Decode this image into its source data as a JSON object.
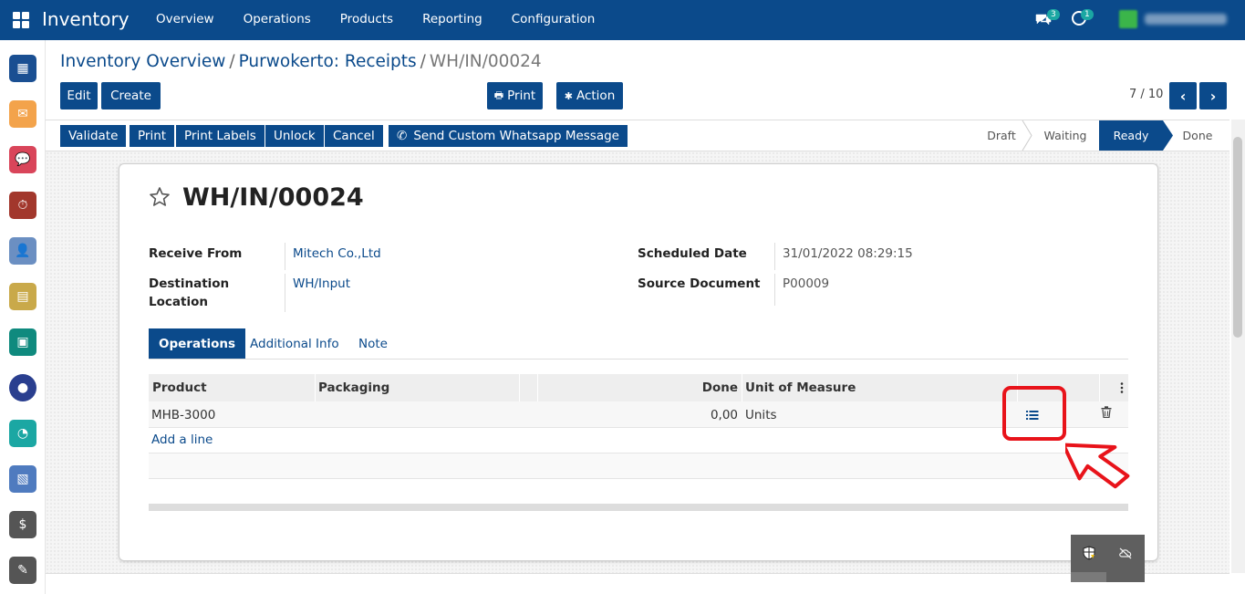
{
  "navbar": {
    "app_name": "Inventory",
    "menu": [
      "Overview",
      "Operations",
      "Products",
      "Reporting",
      "Configuration"
    ],
    "messages_count": "3",
    "activities_count": "1"
  },
  "breadcrumb": {
    "items": [
      "Inventory Overview",
      "Purwokerto: Receipts"
    ],
    "current": "WH/IN/00024"
  },
  "control_panel": {
    "edit_label": "Edit",
    "create_label": "Create",
    "print_label": "Print",
    "action_label": "Action",
    "pager": "7 / 10"
  },
  "status_actions": [
    "Validate",
    "Print",
    "Print Labels",
    "Unlock",
    "Cancel",
    "Send Custom Whatsapp Message"
  ],
  "stages": {
    "items": [
      "Draft",
      "Waiting",
      "Ready",
      "Done"
    ],
    "current": "Ready"
  },
  "record": {
    "name": "WH/IN/00024",
    "receive_from_label": "Receive From",
    "receive_from": "Mitech Co.,Ltd",
    "destination_label_1": "Destination",
    "destination_label_2": "Location",
    "destination": "WH/Input",
    "scheduled_date_label": "Scheduled Date",
    "scheduled_date": "31/01/2022 08:29:15",
    "source_document_label": "Source Document",
    "source_document": "P00009"
  },
  "tabs": [
    "Operations",
    "Additional Info",
    "Note"
  ],
  "table": {
    "columns": [
      "Product",
      "Packaging",
      "Done",
      "Unit of Measure"
    ],
    "rows": [
      {
        "product": "MHB-3000",
        "packaging": "",
        "done": "0,00",
        "uom": "Units"
      }
    ],
    "add_line_label": "Add a line"
  },
  "colors": {
    "primary": "#0b4a8b",
    "highlight": "#e8131a"
  }
}
